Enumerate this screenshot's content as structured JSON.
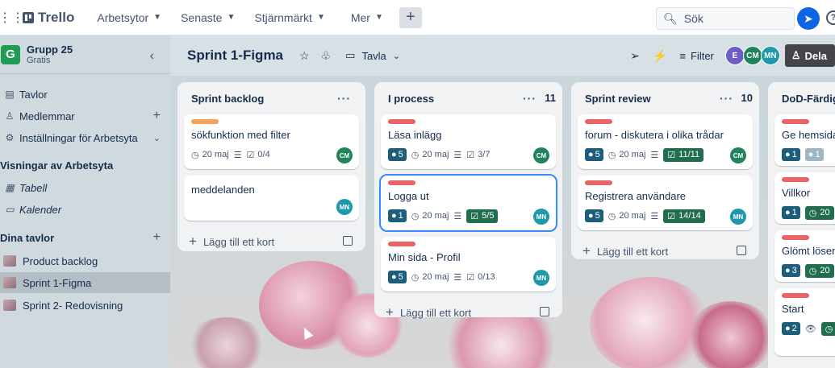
{
  "topbar": {
    "app_name": "Trello",
    "nav": [
      {
        "label": "Arbetsytor"
      },
      {
        "label": "Senaste"
      },
      {
        "label": "Stjärnmärkt"
      },
      {
        "label": "Mer"
      }
    ],
    "create_label": "+",
    "search_placeholder": "Sök",
    "help_label": "?"
  },
  "sidebar": {
    "workspace_initial": "G",
    "workspace_name": "Grupp 25",
    "workspace_plan": "Gratis",
    "items": [
      {
        "label": "Tavlor"
      },
      {
        "label": "Medlemmar"
      },
      {
        "label": "Inställningar för Arbetsyta"
      }
    ],
    "views_heading": "Visningar av Arbetsyta",
    "views": [
      {
        "label": "Tabell"
      },
      {
        "label": "Kalender"
      }
    ],
    "boards_heading": "Dina tavlor",
    "boards": [
      {
        "label": "Product backlog"
      },
      {
        "label": "Sprint 1-Figma"
      },
      {
        "label": "Sprint 2- Redovisning"
      }
    ]
  },
  "board": {
    "title": "Sprint 1-Figma",
    "view_label": "Tavla",
    "filter_label": "Filter",
    "share_label": "Dela",
    "members": [
      {
        "initials": "E",
        "color": "#6e5dc6"
      },
      {
        "initials": "CM",
        "color": "#1f845a"
      },
      {
        "initials": "MN",
        "color": "#1d9aaa"
      }
    ]
  },
  "colors": {
    "label_orange": "#f5a35c",
    "label_red": "#e86565",
    "avatar_cm": "#1f845a",
    "avatar_mn": "#1d9aaa",
    "complete_badge": "#216e4e",
    "points_badge": "#1d5f7a"
  },
  "lists": [
    {
      "title": "Sprint backlog",
      "count": "",
      "add_label": "Lägg till ett kort",
      "cards": [
        {
          "label_color": "orange",
          "title": "sökfunktion med filter",
          "points": "",
          "date": "20 maj",
          "checklist": "0/4",
          "checklist_done": false,
          "member": "CM"
        },
        {
          "label_color": "",
          "title": "meddelanden",
          "points": "",
          "date": "",
          "checklist": "",
          "checklist_done": false,
          "member": "MN"
        }
      ]
    },
    {
      "title": "I process",
      "count": "11",
      "add_label": "Lägg till ett kort",
      "cards": [
        {
          "label_color": "red",
          "title": "Läsa inlägg",
          "points": "5",
          "date": "20 maj",
          "checklist": "3/7",
          "checklist_done": false,
          "member": "CM"
        },
        {
          "label_color": "red",
          "title": "Logga ut",
          "points": "1",
          "date": "20 maj",
          "checklist": "5/5",
          "checklist_done": true,
          "member": "MN"
        },
        {
          "label_color": "red",
          "title": "Min sida - Profil",
          "points": "5",
          "date": "20 maj",
          "checklist": "0/13",
          "checklist_done": false,
          "member": "MN"
        }
      ]
    },
    {
      "title": "Sprint review",
      "count": "10",
      "add_label": "Lägg till ett kort",
      "cards": [
        {
          "label_color": "red",
          "title": "forum - diskutera i olika trådar",
          "points": "5",
          "date": "20 maj",
          "checklist": "11/11",
          "checklist_done": true,
          "member": "CM"
        },
        {
          "label_color": "red",
          "title": "Registrera användare",
          "points": "5",
          "date": "20 maj",
          "checklist": "14/14",
          "checklist_done": true,
          "member": "MN"
        }
      ]
    },
    {
      "title": "DoD-Färdigt",
      "count": "",
      "cards": [
        {
          "title": "Ge hemsidan",
          "points": "1",
          "points2": "1"
        },
        {
          "title": "Villkor",
          "points": "1",
          "date": "20"
        },
        {
          "title": "Glömt lösenord",
          "points": "3",
          "date": "20"
        },
        {
          "title": "Start",
          "points": "2"
        }
      ]
    }
  ]
}
